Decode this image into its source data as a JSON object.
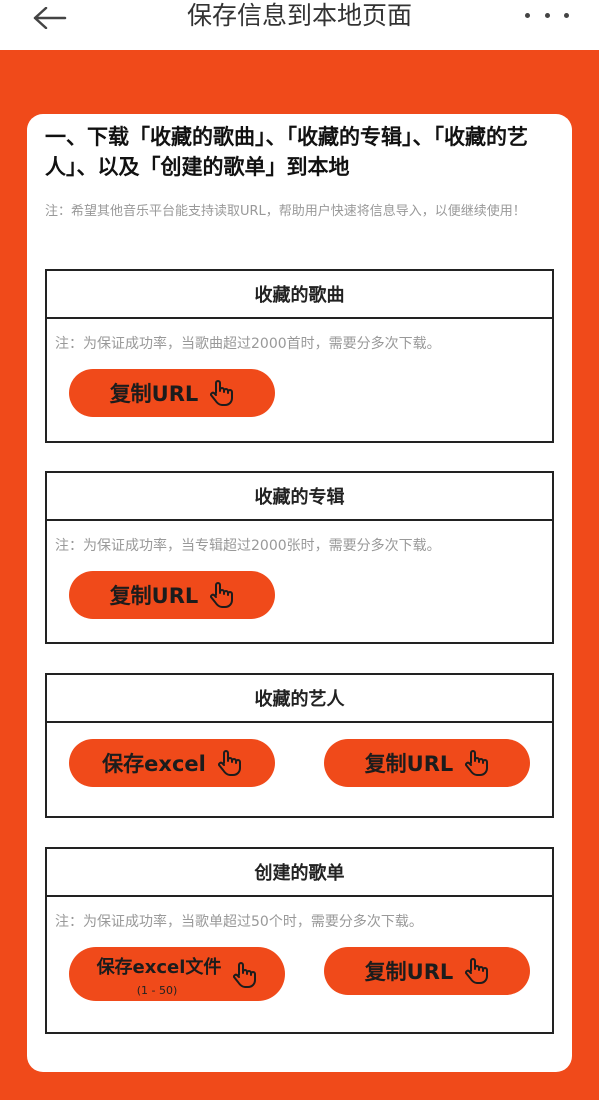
{
  "header": {
    "back_label": "←",
    "title": "保存信息到本地页面"
  },
  "main": {
    "heading": "一、下载「收藏的歌曲」、「收藏的专辑」、「收藏的艺人」、以及「创建的歌单」到本地",
    "note": "注：希望其他音乐平台能支持读取URL，帮助用户快速将信息导入，以便继续使用！",
    "sections": [
      {
        "title": "收藏的歌曲",
        "note": "注：为保证成功率，当歌曲超过2000首时，需要分多次下载。",
        "copy_label": "复制URL"
      },
      {
        "title": "收藏的专辑",
        "note": "注：为保证成功率，当专辑超过2000张时，需要分多次下载。",
        "copy_label": "复制URL"
      },
      {
        "title": "收藏的艺人",
        "save_label": "保存excel",
        "copy_label": "复制URL"
      },
      {
        "title": "创建的歌单",
        "note": "注：为保证成功率，当歌单超过50个时，需要分多次下载。",
        "save_label": "保存excel文件",
        "save_sub": "(1 - 50)",
        "copy_label": "复制URL"
      }
    ]
  },
  "colors": {
    "accent": "#f04a1a",
    "card": "#ffffff",
    "border": "#222222",
    "note_text": "#999999"
  },
  "icons": {
    "back": "arrow-left-icon",
    "more": "more-dots-icon",
    "hand": "hand-pointer-icon"
  }
}
